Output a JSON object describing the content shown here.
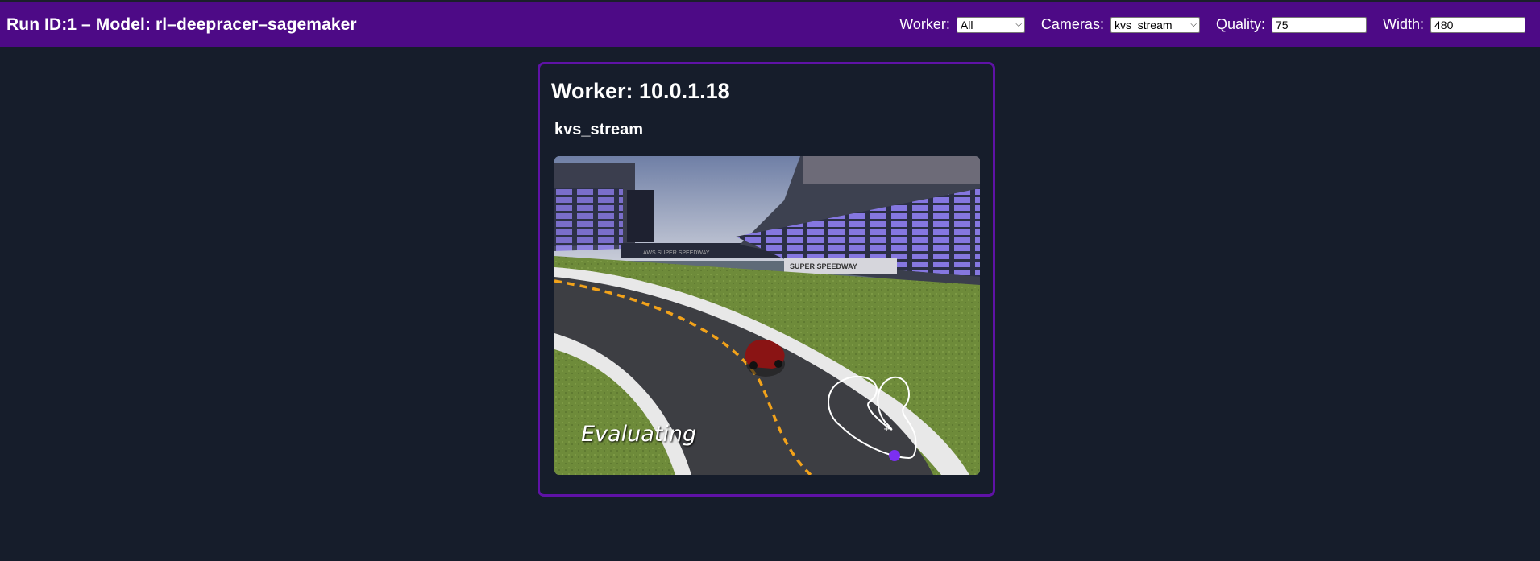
{
  "header": {
    "title": "Run ID:1 – Model: rl–deepracer–sagemaker",
    "worker_label": "Worker:",
    "worker_value": "All",
    "cameras_label": "Cameras:",
    "cameras_value": "kvs_stream",
    "quality_label": "Quality:",
    "quality_value": "75",
    "width_label": "Width:",
    "width_value": "480"
  },
  "card": {
    "title": "Worker: 10.0.1.18",
    "camera_name": "kvs_stream",
    "overlay_text": "Evaluating",
    "signage": [
      "AWS SUPER SPEEDWAY",
      "SUPER SPEEDWAY"
    ]
  },
  "colors": {
    "topbar": "#4d0a86",
    "background": "#161d2b",
    "card_border": "#5f12a6",
    "track_line": "#f2a21a",
    "car": "#8a1414",
    "minimap_dot": "#7b2ff0"
  }
}
